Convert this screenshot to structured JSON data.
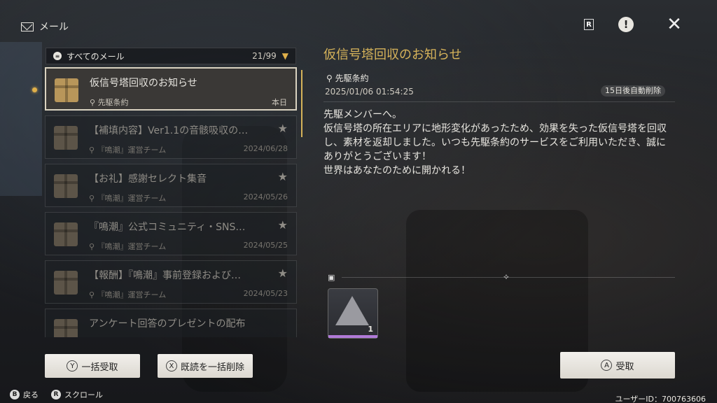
{
  "header": {
    "title": "メール",
    "icon": "mail-icon",
    "right_icons": [
      "r-key-icon",
      "alert-icon",
      "close-icon"
    ]
  },
  "filter": {
    "label": "すべてのメール",
    "count": "21/99"
  },
  "mails": [
    {
      "subject": "仮信号塔回収のお知らせ",
      "sender": "先駆条約",
      "date": "本日",
      "selected": true,
      "starred": false
    },
    {
      "subject": "【補填内容】Ver1.1の音骸吸収の…",
      "sender": "『鳴潮』運営チーム",
      "date": "2024/06/28",
      "selected": false,
      "starred": true
    },
    {
      "subject": "【お礼】感謝セレクト集音",
      "sender": "『鳴潮』運営チーム",
      "date": "2024/05/26",
      "selected": false,
      "starred": true
    },
    {
      "subject": "『鳴潮』公式コミュニティ・SNS…",
      "sender": "『鳴潮』運営チーム",
      "date": "2024/05/25",
      "selected": false,
      "starred": true
    },
    {
      "subject": "【報酬】『鳴潮』事前登録および…",
      "sender": "『鳴潮』運営チーム",
      "date": "2024/05/23",
      "selected": false,
      "starred": true
    },
    {
      "subject": "アンケート回答のプレゼントの配布",
      "sender": "",
      "date": "",
      "selected": false,
      "starred": false
    }
  ],
  "detail": {
    "title": "仮信号塔回収のお知らせ",
    "sender": "先駆条約",
    "datetime": "2025/01/06 01:54:25",
    "expire": "15日後自動削除",
    "body": "先駆メンバーへ。\n仮信号塔の所在エリアに地形変化があったため、効果を失った仮信号塔を回収し、素材を返却しました。いつも先駆条約のサービスをご利用いただき、誠にありがとうございます！\n世界はあなたのために開かれる！",
    "reward_qty": "1"
  },
  "buttons": {
    "claim_all": "一括受取",
    "claim_all_key": "Y",
    "delete_read": "既読を一括削除",
    "delete_read_key": "X",
    "claim": "受取",
    "claim_key": "A"
  },
  "footer": {
    "back_key": "B",
    "back": "戻る",
    "scroll_key": "R",
    "scroll": "スクロール",
    "user_id": "ユーザーID：700763606"
  }
}
